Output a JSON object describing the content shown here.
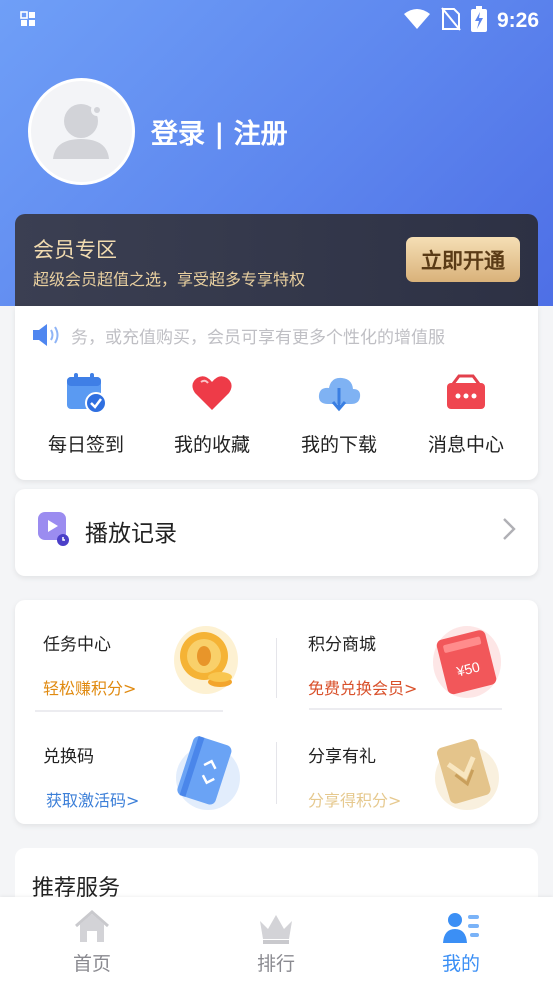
{
  "status_bar": {
    "time": "9:26"
  },
  "profile": {
    "login_label": "登录 | 注册"
  },
  "vip": {
    "title": "会员专区",
    "subtitle": "超级会员超值之选，享受超多专享特权",
    "button_label": "立即开通"
  },
  "notice": {
    "text": "务，或充值购买，会员可享有更多个性化的增值服"
  },
  "quick_actions": [
    {
      "label": "每日签到",
      "icon": "calendar-check-icon"
    },
    {
      "label": "我的收藏",
      "icon": "heart-icon"
    },
    {
      "label": "我的下载",
      "icon": "cloud-download-icon"
    },
    {
      "label": "消息中心",
      "icon": "message-box-icon"
    }
  ],
  "play_record": {
    "label": "播放记录"
  },
  "tasks": [
    {
      "title": "任务中心",
      "subtitle": "轻松赚积分>",
      "color": "#e08a10"
    },
    {
      "title": "积分商城",
      "subtitle": "免费兑换会员>",
      "color": "#d9502a"
    },
    {
      "title": "兑换码",
      "subtitle": "获取激活码>",
      "color": "#3c7fd8"
    },
    {
      "title": "分享有礼",
      "subtitle": "分享得积分>",
      "color": "#e6c98f"
    }
  ],
  "coupon_value": "¥50",
  "recommend": {
    "title": "推荐服务"
  },
  "bottom_nav": [
    {
      "label": "首页",
      "icon": "home-icon",
      "active": false
    },
    {
      "label": "排行",
      "icon": "crown-icon",
      "active": false
    },
    {
      "label": "我的",
      "icon": "user-list-icon",
      "active": true
    }
  ],
  "colors": {
    "hero_start": "#6f9ff7",
    "hero_end": "#4e6fe6",
    "accent": "#3b8ff5",
    "vip_gold": "#d9b27a"
  }
}
